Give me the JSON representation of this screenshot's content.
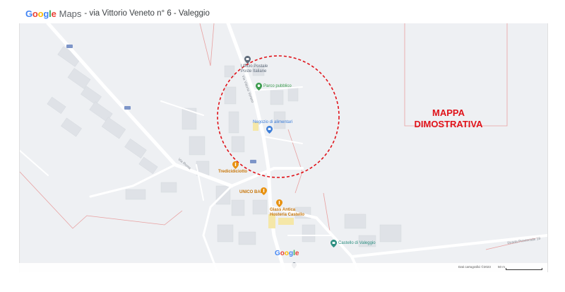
{
  "header": {
    "brand_letters": [
      "G",
      "o",
      "o",
      "g",
      "l",
      "e"
    ],
    "brand_colors": [
      "#4285F4",
      "#EA4335",
      "#FBBC05",
      "#4285F4",
      "#34A853",
      "#EA4335"
    ],
    "product": "Maps",
    "title": "- via Vittorio Veneto n° 6 - Valeggio"
  },
  "map": {
    "background_color": "#eef0f3",
    "road_color": "#ffffff",
    "building_color": "#dfe2e7",
    "boundary_color": "#e8a0a0",
    "highlight_circle_color": "#e0131a",
    "overlay_text": "MAPPA\nDIMOSTRATIVA",
    "pois": [
      {
        "id": "post",
        "name": "Ufficio Postale\nPoste Italiane",
        "icon": "post-office-icon",
        "color": "#5f6b7a"
      },
      {
        "id": "parco",
        "name": "Parco pubblico",
        "icon": "park-icon",
        "color": "#3a9b4c"
      },
      {
        "id": "negozio",
        "name": "Negozio di alimentari",
        "icon": "shopping-icon",
        "color": "#3b7dd8"
      },
      {
        "id": "tredici",
        "name": "Tredicidiciotto",
        "icon": "restaurant-icon",
        "color": "#e8910f"
      },
      {
        "id": "unico",
        "name": "UNICO BAR",
        "icon": "restaurant-icon",
        "color": "#e8910f"
      },
      {
        "id": "glass",
        "name": "Glass Antica\nHosteria Castello",
        "icon": "restaurant-icon",
        "color": "#e8910f"
      },
      {
        "id": "castello",
        "name": "Castello di Valeggio",
        "icon": "landmark-icon",
        "color": "#2c8f81"
      }
    ],
    "streets": {
      "via_roma": "Via Roma",
      "via_vittorio": "Via Vittorio Veneto",
      "strada_provinciale": "Strada Provinciale 19"
    }
  },
  "footer": {
    "logo_letters": [
      "G",
      "o",
      "o",
      "g",
      "l",
      "e"
    ],
    "copyright": "Dati cartografici ©2023",
    "scale_label": "50 m"
  }
}
